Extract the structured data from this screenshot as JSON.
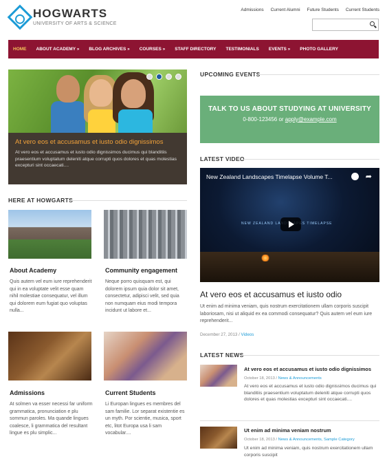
{
  "brand": {
    "name": "HOGWARTS",
    "tagline": "UNIVERSITY OF ARTS & SCIENCE"
  },
  "top_links": [
    "Admissions",
    "Current Alumni",
    "Future Students",
    "Current Students"
  ],
  "search": {
    "placeholder": ""
  },
  "nav": [
    {
      "label": "HOME",
      "active": true
    },
    {
      "label": "ABOUT ACADEMY »"
    },
    {
      "label": "BLOG ARCHIVES »"
    },
    {
      "label": "COURSES »"
    },
    {
      "label": "STAFF DIRECTORY"
    },
    {
      "label": "TESTIMONIALS"
    },
    {
      "label": "EVENTS »"
    },
    {
      "label": "PHOTO GALLERY"
    }
  ],
  "slider": {
    "title": "At vero eos et accusamus et iusto odio dignissimos",
    "text": "At vero eos et accusamus et iusto odio dignissimos ducimus qui blanditiis praesentium voluptatum deleniti atque corrupti quos dolores et quas molestias excepturi sint occaecati....",
    "dots": 4,
    "active_dot": 1
  },
  "here": {
    "heading": "HERE AT HOWGARTS",
    "cards": [
      {
        "title": "About Academy",
        "text": "Quis autem vel eum iure reprehenderit qui in ea voluptate velit esse quam nihil molestiae consequatur, vel illum qui dolorem eum fugiat quo voluptas nulla..."
      },
      {
        "title": "Community engagement",
        "text": "Neque porro quisquam est, qui dolorem ipsum quia dolor sit amet, consectetur, adipisci velit, sed quia non numquam eius modi tempora incidunt ut labore et..."
      },
      {
        "title": "Admissions",
        "text": "At solmen va esser necessi far uniform grammatica, pronunciation e plu sommun paroles. Ma quande lingues coalesce, li grammatica del resultant lingue es plu simplic..."
      },
      {
        "title": "Current Students",
        "text": "Li Europan lingues es membres del sam familie. Lor separat existentie es un myth. Por scientie, musica, sport etc, litot Europa usa li sam vocabular...."
      }
    ]
  },
  "events": {
    "heading": "UPCOMING EVENTS"
  },
  "cta": {
    "title": "TALK TO US ABOUT STUDYING AT UNIVERSITY",
    "phone": "0-800-123456",
    "or": " or ",
    "email": "apply@example.com"
  },
  "video": {
    "heading": "LATEST VIDEO",
    "title": "New Zealand Landscapes Timelapse Volume T...",
    "overlay": "NEW ZEALAND LANDSCAPES TIMELAPSE"
  },
  "featured": {
    "title": "At vero eos et accusamus et iusto odio",
    "text": "Ut enim ad minima veniam, quis nostrum exercitationem ullam corporis suscipit laboriosam, nisi ut aliquid ex ea commodi consequatur? Quis autem vel eum iure reprehenderit...",
    "date": "December 27, 2013",
    "sep": " / ",
    "category": "Videos"
  },
  "news": {
    "heading": "LATEST NEWS",
    "items": [
      {
        "title": "At vero eos et accusamus et iusto odio dignissimos",
        "date": "October 18, 2013",
        "sep": " / ",
        "category": "News & Announcements",
        "text": "At vero eos et accusamus et iusto odio dignissimos ducimus qui blanditiis praesentium voluptatum deleniti atque corrupti quos dolores et quas molestias excepturi sint occaecati...."
      },
      {
        "title": "Ut enim ad minima veniam nostrum",
        "date": "October 18, 2013",
        "sep": " / ",
        "category": "News & Announcements, Sample Category",
        "text": "Ut enim ad minima veniam, quis nostrum exercitationem ullam corporis suscipit"
      }
    ]
  },
  "colors": {
    "nav_bg": "#8d1432",
    "nav_active": "#f4c45a",
    "cta_bg": "#6aaf7a",
    "accent": "#1c9bd6",
    "caption_title": "#f2a23a"
  }
}
